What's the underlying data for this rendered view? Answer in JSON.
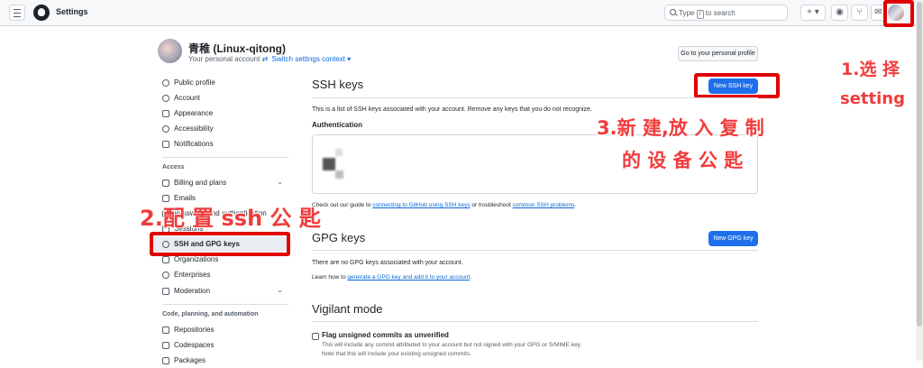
{
  "topbar": {
    "title": "Settings",
    "search_placeholder_prefix": "Type",
    "search_shortcut": "/",
    "search_placeholder_suffix": "to search",
    "plus_label": "+ ▾"
  },
  "profile": {
    "name": "青稚 (Linux-qitong)",
    "subtitle": "Your personal account",
    "switch_link": "Switch settings context ▾",
    "go_profile_button": "Go to your personal profile"
  },
  "sidebar": {
    "items_top": [
      {
        "label": "Public profile"
      },
      {
        "label": "Account"
      },
      {
        "label": "Appearance"
      },
      {
        "label": "Accessibility"
      },
      {
        "label": "Notifications"
      }
    ],
    "access_heading": "Access",
    "items_access": [
      {
        "label": "Billing and plans",
        "chevron": "⌄"
      },
      {
        "label": "Emails",
        "chevron": ""
      },
      {
        "label": "Password and authentication",
        "chevron": ""
      },
      {
        "label": "Sessions",
        "chevron": ""
      },
      {
        "label": "SSH and GPG keys",
        "chevron": "",
        "active": true
      },
      {
        "label": "Organizations",
        "chevron": ""
      },
      {
        "label": "Enterprises",
        "chevron": ""
      },
      {
        "label": "Moderation",
        "chevron": "⌄"
      }
    ],
    "code_heading": "Code, planning, and automation",
    "items_code": [
      {
        "label": "Repositories"
      },
      {
        "label": "Codespaces"
      },
      {
        "label": "Packages"
      }
    ]
  },
  "ssh": {
    "title": "SSH keys",
    "new_button": "New SSH key",
    "intro": "This is a list of SSH keys associated with your account. Remove any keys that you do not recognize.",
    "auth_heading": "Authentication",
    "guide_prefix": "Check out our guide to",
    "guide_link": "connecting to GitHub using SSH keys",
    "guide_middle": "or troubleshoot",
    "guide_link2": "common SSH problems",
    "guide_suffix": "."
  },
  "gpg": {
    "title": "GPG keys",
    "new_button": "New GPG key",
    "empty": "There are no GPG keys associated with your account.",
    "learn_prefix": "Learn how to",
    "learn_link": "generate a GPG key and add it to your account",
    "learn_suffix": "."
  },
  "vigilant": {
    "title": "Vigilant mode",
    "checkbox_label": "Flag unsigned commits as unverified",
    "desc1": "This will include any commit attributed to your account but not signed with your GPG or S/MIME key.",
    "desc2": "Note that this will include your existing unsigned commits."
  },
  "annotations": {
    "step1_line1": "1.选 择",
    "step1_line2": "setting",
    "step2": "2.配 置 ssh 公 匙",
    "step3_line1": "3.新 建,放 入 复 制",
    "step3_line2": "的 设 备 公 匙"
  },
  "colors": {
    "annotation": "#f03c3c",
    "highlight_box": "#e10000",
    "primary_button": "#1f6feb",
    "link": "#0969da"
  }
}
